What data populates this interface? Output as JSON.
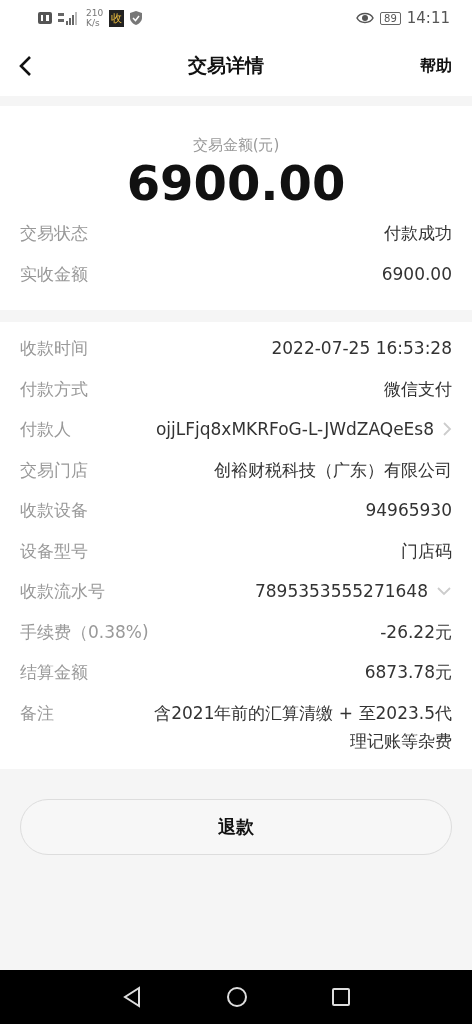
{
  "status_bar": {
    "speed": "210",
    "speed_unit": "K/s",
    "app_badge": "收",
    "battery": "89",
    "time": "14:11"
  },
  "header": {
    "title": "交易详情",
    "action": "帮助"
  },
  "summary": {
    "amount_label": "交易金额(元)",
    "amount": "6900.00",
    "rows": [
      {
        "label": "交易状态",
        "value": "付款成功"
      },
      {
        "label": "实收金额",
        "value": "6900.00"
      }
    ]
  },
  "details": [
    {
      "label": "收款时间",
      "value": "2022-07-25 16:53:28",
      "kind": "plain"
    },
    {
      "label": "付款方式",
      "value": "微信支付",
      "kind": "plain"
    },
    {
      "label": "付款人",
      "value": "ojjLFjq8xMKRFoG-L-JWdZAQeEs8",
      "kind": "link"
    },
    {
      "label": "交易门店",
      "value": "创裕财税科技（广东）有限公司",
      "kind": "plain"
    },
    {
      "label": "收款设备",
      "value": "94965930",
      "kind": "plain"
    },
    {
      "label": "设备型号",
      "value": "门店码",
      "kind": "plain"
    },
    {
      "label": "收款流水号",
      "value": "7895353555271648",
      "kind": "expandable"
    },
    {
      "label": "手续费（0.38%)",
      "value": "-26.22元",
      "kind": "plain"
    },
    {
      "label": "结算金额",
      "value": "6873.78元",
      "kind": "plain"
    },
    {
      "label": "备注",
      "value": "含2021年前的汇算清缴 + 至2023.5代理记账等杂费",
      "kind": "plain"
    }
  ],
  "refund_button": "退款"
}
